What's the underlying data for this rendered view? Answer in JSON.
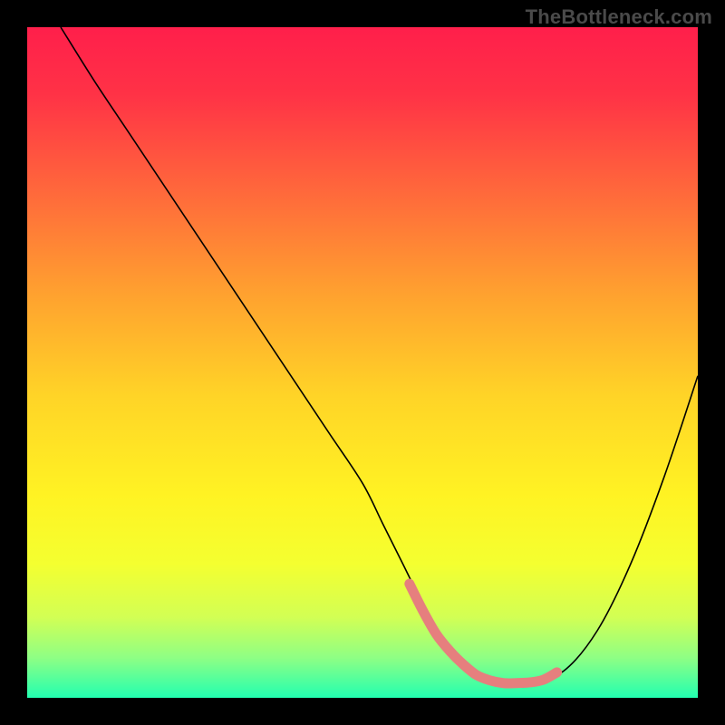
{
  "attribution": "TheBottleneck.com",
  "gradient_stops": [
    {
      "offset": 0.0,
      "color": "#ff1f4b"
    },
    {
      "offset": 0.1,
      "color": "#ff3246"
    },
    {
      "offset": 0.25,
      "color": "#ff6a3b"
    },
    {
      "offset": 0.4,
      "color": "#ffa22f"
    },
    {
      "offset": 0.55,
      "color": "#ffd427"
    },
    {
      "offset": 0.7,
      "color": "#fff323"
    },
    {
      "offset": 0.8,
      "color": "#f4ff30"
    },
    {
      "offset": 0.88,
      "color": "#d2ff54"
    },
    {
      "offset": 0.94,
      "color": "#8fff84"
    },
    {
      "offset": 1.0,
      "color": "#22ffb0"
    }
  ],
  "chart_data": {
    "type": "line",
    "title": "",
    "xlabel": "",
    "ylabel": "",
    "xlim": [
      0,
      100
    ],
    "ylim": [
      0,
      100
    ],
    "grid": false,
    "legend": false,
    "series": [
      {
        "name": "bottleneck-curve",
        "color": "#000000",
        "x": [
          5,
          10,
          15,
          20,
          25,
          30,
          35,
          40,
          45,
          50,
          53,
          56,
          59,
          62,
          65,
          68,
          71,
          75,
          80,
          85,
          90,
          95,
          100
        ],
        "y": [
          100,
          92,
          84.5,
          77,
          69.5,
          62,
          54.5,
          47,
          39.5,
          32,
          26,
          20,
          14,
          9,
          5,
          3,
          2.2,
          2.2,
          4,
          10,
          20,
          33,
          48
        ]
      },
      {
        "name": "optimal-region",
        "color": "#e67f7e",
        "stroke_width": 10,
        "linecap": "round",
        "x": [
          57,
          59,
          61,
          63,
          65,
          67,
          69,
          71,
          73,
          75,
          77,
          79
        ],
        "y": [
          17,
          13,
          9.5,
          7,
          5,
          3.4,
          2.6,
          2.2,
          2.2,
          2.3,
          2.7,
          3.8
        ]
      }
    ]
  }
}
